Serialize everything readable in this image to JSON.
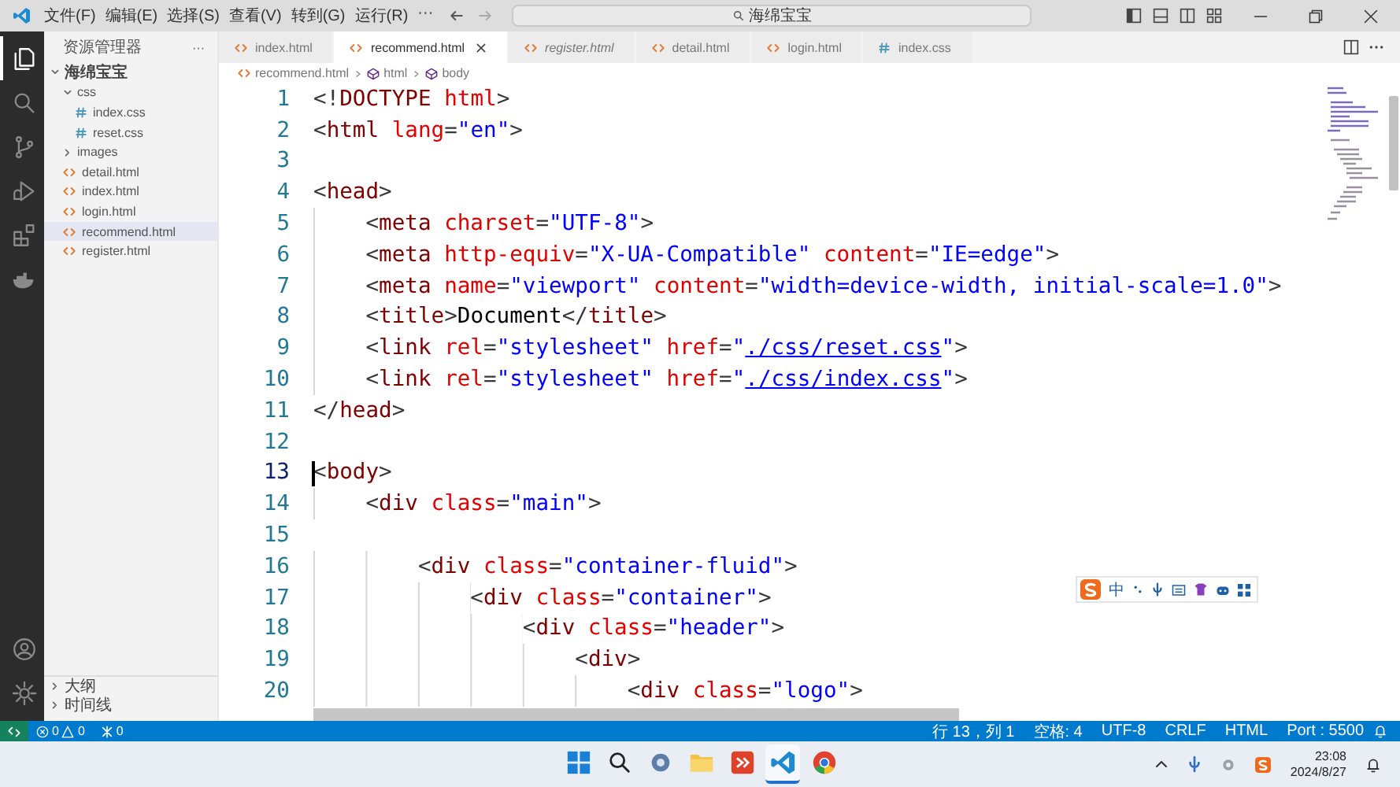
{
  "title_bar": {
    "menus": [
      "文件(F)",
      "编辑(E)",
      "选择(S)",
      "查看(V)",
      "转到(G)",
      "运行(R)",
      "···"
    ],
    "search": {
      "value": "海绵宝宝"
    }
  },
  "activity_bar": {
    "items": [
      {
        "kind": "files",
        "selected": true
      },
      {
        "kind": "search",
        "selected": false
      },
      {
        "kind": "git",
        "selected": false
      },
      {
        "kind": "run",
        "selected": false
      },
      {
        "kind": "extensions",
        "selected": false
      },
      {
        "kind": "docker",
        "selected": false
      }
    ],
    "bottom": [
      {
        "kind": "account"
      },
      {
        "kind": "settings"
      }
    ]
  },
  "sidebar": {
    "title": "资源管理器",
    "more": "···",
    "tree": [
      {
        "label": "海绵宝宝",
        "kind": "folder",
        "expanded": true,
        "selected": false,
        "children": [
          {
            "label": "css",
            "kind": "folder",
            "expanded": true,
            "selected": false,
            "children": [
              {
                "label": "index.css",
                "kind": "css",
                "selected": false
              },
              {
                "label": "reset.css",
                "kind": "css",
                "selected": false
              }
            ]
          },
          {
            "label": "images",
            "kind": "folder",
            "expanded": false,
            "selected": false
          },
          {
            "label": "detail.html",
            "kind": "html",
            "selected": false
          },
          {
            "label": "index.html",
            "kind": "html",
            "selected": false
          },
          {
            "label": "login.html",
            "kind": "html",
            "selected": false
          },
          {
            "label": "recommend.html",
            "kind": "html",
            "selected": true
          },
          {
            "label": "register.html",
            "kind": "html",
            "selected": false
          }
        ]
      }
    ],
    "panels": [
      {
        "label": "大纲",
        "expanded": false
      },
      {
        "label": "时间线",
        "expanded": false
      }
    ]
  },
  "tabs": [
    {
      "label": "index.html",
      "kind": "html",
      "selected": false,
      "preview": false
    },
    {
      "label": "recommend.html",
      "kind": "html",
      "selected": true,
      "preview": false
    },
    {
      "label": "register.html",
      "kind": "html",
      "selected": false,
      "preview": true
    },
    {
      "label": "detail.html",
      "kind": "html",
      "selected": false,
      "preview": false
    },
    {
      "label": "login.html",
      "kind": "html",
      "selected": false,
      "preview": false
    },
    {
      "label": "index.css",
      "kind": "css",
      "selected": false,
      "preview": false
    }
  ],
  "breadcrumb": [
    {
      "label": "recommend.html",
      "kind": "html"
    },
    {
      "label": "html",
      "kind": "element"
    },
    {
      "label": "body",
      "kind": "element"
    }
  ],
  "editor": {
    "lines": [
      {
        "number": "1",
        "current": false,
        "tokens": [
          {
            "kind": "p",
            "text": "<!"
          },
          {
            "kind": "tag",
            "text": "DOCTYPE"
          },
          {
            "kind": "attr",
            "text": " html"
          },
          {
            "kind": "p",
            "text": ">"
          }
        ]
      },
      {
        "number": "2",
        "current": false,
        "tokens": [
          {
            "kind": "p",
            "text": "<"
          },
          {
            "kind": "tag",
            "text": "html"
          },
          {
            "kind": "attr",
            "text": " lang"
          },
          {
            "kind": "p",
            "text": "="
          },
          {
            "kind": "str",
            "text": "\"en\""
          },
          {
            "kind": "p",
            "text": ">"
          }
        ]
      },
      {
        "number": "3",
        "current": false
      },
      {
        "number": "4",
        "current": false,
        "tokens": [
          {
            "kind": "p",
            "text": "<"
          },
          {
            "kind": "tag",
            "text": "head"
          },
          {
            "kind": "p",
            "text": ">"
          }
        ]
      },
      {
        "number": "5",
        "current": false,
        "tokens": [
          {
            "kind": "p",
            "text": "    <"
          },
          {
            "kind": "tag",
            "text": "meta"
          },
          {
            "kind": "attr",
            "text": " charset"
          },
          {
            "kind": "p",
            "text": "="
          },
          {
            "kind": "str",
            "text": "\"UTF-8\""
          },
          {
            "kind": "p",
            "text": ">"
          }
        ]
      },
      {
        "number": "6",
        "current": false,
        "tokens": [
          {
            "kind": "p",
            "text": "    <"
          },
          {
            "kind": "tag",
            "text": "meta"
          },
          {
            "kind": "attr",
            "text": " http-equiv"
          },
          {
            "kind": "p",
            "text": "="
          },
          {
            "kind": "str",
            "text": "\"X-UA-Compatible\""
          },
          {
            "kind": "attr",
            "text": " content"
          },
          {
            "kind": "p",
            "text": "="
          },
          {
            "kind": "str",
            "text": "\"IE=edge\""
          },
          {
            "kind": "p",
            "text": ">"
          }
        ]
      },
      {
        "number": "7",
        "current": false,
        "tokens": [
          {
            "kind": "p",
            "text": "    <"
          },
          {
            "kind": "tag",
            "text": "meta"
          },
          {
            "kind": "attr",
            "text": " name"
          },
          {
            "kind": "p",
            "text": "="
          },
          {
            "kind": "str",
            "text": "\"viewport\""
          },
          {
            "kind": "attr",
            "text": " content"
          },
          {
            "kind": "p",
            "text": "="
          },
          {
            "kind": "str",
            "text": "\"width=device-width, initial-scale=1.0\""
          },
          {
            "kind": "p",
            "text": ">"
          }
        ]
      },
      {
        "number": "8",
        "current": false,
        "tokens": [
          {
            "kind": "p",
            "text": "    <"
          },
          {
            "kind": "tag",
            "text": "title"
          },
          {
            "kind": "p",
            "text": ">"
          },
          {
            "kind": "text",
            "text": "Document"
          },
          {
            "kind": "p",
            "text": "</"
          },
          {
            "kind": "tag",
            "text": "title"
          },
          {
            "kind": "p",
            "text": ">"
          }
        ]
      },
      {
        "number": "9",
        "current": false,
        "tokens": [
          {
            "kind": "p",
            "text": "    <"
          },
          {
            "kind": "tag",
            "text": "link"
          },
          {
            "kind": "attr",
            "text": " rel"
          },
          {
            "kind": "p",
            "text": "="
          },
          {
            "kind": "str",
            "text": "\"stylesheet\""
          },
          {
            "kind": "attr",
            "text": " href"
          },
          {
            "kind": "p",
            "text": "="
          },
          {
            "kind": "str",
            "text": "\""
          },
          {
            "kind": "link",
            "text": "./css/reset.css"
          },
          {
            "kind": "str",
            "text": "\""
          },
          {
            "kind": "p",
            "text": ">"
          }
        ]
      },
      {
        "number": "10",
        "current": false,
        "tokens": [
          {
            "kind": "p",
            "text": "    <"
          },
          {
            "kind": "tag",
            "text": "link"
          },
          {
            "kind": "attr",
            "text": " rel"
          },
          {
            "kind": "p",
            "text": "="
          },
          {
            "kind": "str",
            "text": "\"stylesheet\""
          },
          {
            "kind": "attr",
            "text": " href"
          },
          {
            "kind": "p",
            "text": "="
          },
          {
            "kind": "str",
            "text": "\""
          },
          {
            "kind": "link",
            "text": "./css/index.css"
          },
          {
            "kind": "str",
            "text": "\""
          },
          {
            "kind": "p",
            "text": ">"
          }
        ]
      },
      {
        "number": "11",
        "current": false,
        "tokens": [
          {
            "kind": "p",
            "text": "</"
          },
          {
            "kind": "tag",
            "text": "head"
          },
          {
            "kind": "p",
            "text": ">"
          }
        ]
      },
      {
        "number": "12",
        "current": false
      },
      {
        "number": "13",
        "current": true,
        "tokens": [
          {
            "kind": "p",
            "text": "<"
          },
          {
            "kind": "tag",
            "text": "body"
          },
          {
            "kind": "p",
            "text": ">"
          }
        ]
      },
      {
        "number": "14",
        "current": false,
        "tokens": [
          {
            "kind": "p",
            "text": "    <"
          },
          {
            "kind": "tag",
            "text": "div"
          },
          {
            "kind": "attr",
            "text": " class"
          },
          {
            "kind": "p",
            "text": "="
          },
          {
            "kind": "str",
            "text": "\"main\""
          },
          {
            "kind": "p",
            "text": ">"
          }
        ]
      },
      {
        "number": "15",
        "current": false
      },
      {
        "number": "16",
        "current": false,
        "tokens": [
          {
            "kind": "p",
            "text": "        <"
          },
          {
            "kind": "tag",
            "text": "div"
          },
          {
            "kind": "attr",
            "text": " class"
          },
          {
            "kind": "p",
            "text": "="
          },
          {
            "kind": "str",
            "text": "\"container-fluid\""
          },
          {
            "kind": "p",
            "text": ">"
          }
        ]
      },
      {
        "number": "17",
        "current": false,
        "tokens": [
          {
            "kind": "p",
            "text": "            <"
          },
          {
            "kind": "tag",
            "text": "div"
          },
          {
            "kind": "attr",
            "text": " class"
          },
          {
            "kind": "p",
            "text": "="
          },
          {
            "kind": "str",
            "text": "\"container\""
          },
          {
            "kind": "p",
            "text": ">"
          }
        ]
      },
      {
        "number": "18",
        "current": false,
        "tokens": [
          {
            "kind": "p",
            "text": "                <"
          },
          {
            "kind": "tag",
            "text": "div"
          },
          {
            "kind": "attr",
            "text": " class"
          },
          {
            "kind": "p",
            "text": "="
          },
          {
            "kind": "str",
            "text": "\"header\""
          },
          {
            "kind": "p",
            "text": ">"
          }
        ]
      },
      {
        "number": "19",
        "current": false,
        "tokens": [
          {
            "kind": "p",
            "text": "                    <"
          },
          {
            "kind": "tag",
            "text": "div"
          },
          {
            "kind": "p",
            "text": ">"
          }
        ]
      },
      {
        "number": "20",
        "current": false,
        "tokens": [
          {
            "kind": "p",
            "text": "                        <"
          },
          {
            "kind": "tag",
            "text": "div"
          },
          {
            "kind": "attr",
            "text": " class"
          },
          {
            "kind": "p",
            "text": "="
          },
          {
            "kind": "str",
            "text": "\"logo\""
          },
          {
            "kind": "p",
            "text": ">"
          }
        ]
      }
    ]
  },
  "ime_toolbar": {
    "label": "中"
  },
  "status_bar": {
    "errors": "0",
    "warnings": "0",
    "ports": "0",
    "right": [
      "行 13，列 1",
      "空格: 4",
      "UTF-8",
      "CRLF",
      "HTML",
      "Port : 5500"
    ]
  },
  "taskbar": {
    "apps": [
      {
        "kind": "start",
        "active": false
      },
      {
        "kind": "search",
        "active": false
      },
      {
        "kind": "settings",
        "active": false
      },
      {
        "kind": "folder",
        "active": false
      },
      {
        "kind": "red-app",
        "active": false
      },
      {
        "kind": "vscode",
        "active": true
      },
      {
        "kind": "chrome",
        "active": false
      }
    ],
    "time": "23:08",
    "date": "2024/8/27"
  }
}
